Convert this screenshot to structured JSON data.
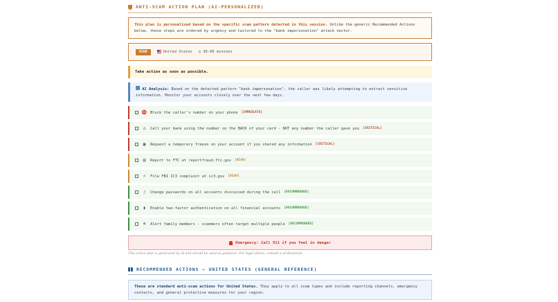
{
  "plan": {
    "title": "ANTI-SCAM ACTION PLAN (AI-PERSONALIZED)",
    "intro_bold": "This plan is personalized based on the specific scam pattern detected in this session.",
    "intro_rest": " Unlike the generic Recommended Actions below, these steps are ordered by urgency and tailored to the \"bank impersonation\" attack vector.",
    "severity_badge": "HIGH",
    "country": "United States",
    "time_estimate": "30-60 minutes",
    "urgent_text": "Take action as soon as possible.",
    "ai_label": "AI Analysis:",
    "ai_text": " Based on the detected pattern \"bank impersonation\", the caller was likely attempting to extract sensitive information. Monitor your accounts closely over the next few days.",
    "steps": [
      {
        "text": "Block the caller's number on your phone",
        "tag": "[IMMEDIATE]",
        "level": "crit",
        "icon": "no-entry-icon"
      },
      {
        "text": "Call your bank using the number on the BACK of your card - NOT any number the caller gave you",
        "tag": "[CRITICAL]",
        "level": "crit",
        "icon": "bank-icon"
      },
      {
        "text": "Request a temporary freeze on your account if you shared any information",
        "tag": "[CRITICAL]",
        "level": "crit",
        "icon": "lock-icon"
      },
      {
        "text": "Report to FTC at reportfraud.ftc.gov",
        "tag": "[HIGH]",
        "level": "high",
        "icon": "document-icon"
      },
      {
        "text": "File FBI IC3 complaint at ic3.gov",
        "tag": "[HIGH]",
        "level": "high",
        "icon": "magnifier-icon"
      },
      {
        "text": "Change passwords on all accounts discussed during the call",
        "tag": "[RECOMMENDED]",
        "level": "rec",
        "icon": "key-icon"
      },
      {
        "text": "Enable two-factor authentication on all financial accounts",
        "tag": "[RECOMMENDED]",
        "level": "rec",
        "icon": "phone-icon"
      },
      {
        "text": "Alert family members - scammers often target multiple people",
        "tag": "[RECOMMENDED]",
        "level": "rec",
        "icon": "family-icon"
      }
    ],
    "emergency_text": "Emergency: Call 911 if you feel in danger",
    "disclaimer": "This action plan is generated by AI and should be used as guidance. For legal advice, consult a professional."
  },
  "recommended": {
    "title": "RECOMMENDED ACTIONS — UNITED STATES (GENERAL REFERENCE)",
    "bold": "These are standard anti-scam actions for United States.",
    "rest": " They apply to all scam types and include reporting channels, emergency contacts, and general protective measures for your region."
  },
  "colors": {
    "accent_orange": "#c97b2e",
    "critical_red": "#c0392b",
    "recommended_green": "#3f8f3f",
    "info_blue": "#2b5c8a"
  }
}
